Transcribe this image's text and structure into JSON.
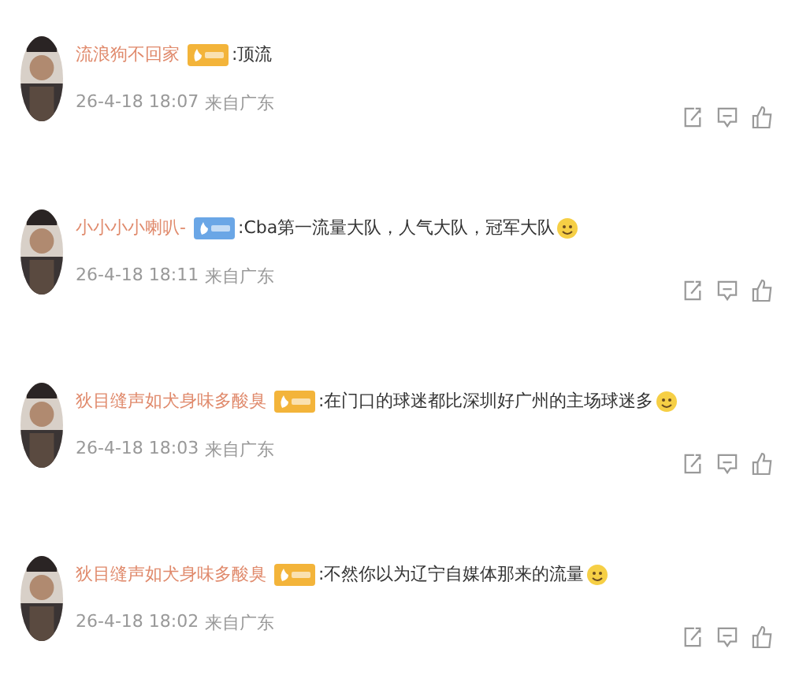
{
  "comments": [
    {
      "user": "流浪狗不回家",
      "badge": {
        "color": "#f3b43a"
      },
      "text": ":顶流",
      "emoji": false,
      "time": "26-4-18 18:07",
      "location": "来自广东"
    },
    {
      "user": "小小小小喇叭-",
      "badge": {
        "color": "#6aa6e6"
      },
      "text": ":Cba第一流量大队，人气大队，冠军大队",
      "emoji": true,
      "time": "26-4-18 18:11",
      "location": "来自广东"
    },
    {
      "user": "狄目缝声如犬身味多酸臭",
      "badge": {
        "color": "#f3b43a"
      },
      "text": ":在门口的球迷都比深圳好广州的主场球迷多",
      "emoji": true,
      "time": "26-4-18 18:03",
      "location": "来自广东"
    },
    {
      "user": "狄目缝声如犬身味多酸臭",
      "badge": {
        "color": "#f3b43a"
      },
      "text": ":不然你以为辽宁自媒体那来的流量",
      "emoji": true,
      "time": "26-4-18 18:02",
      "location": "来自广东"
    }
  ]
}
